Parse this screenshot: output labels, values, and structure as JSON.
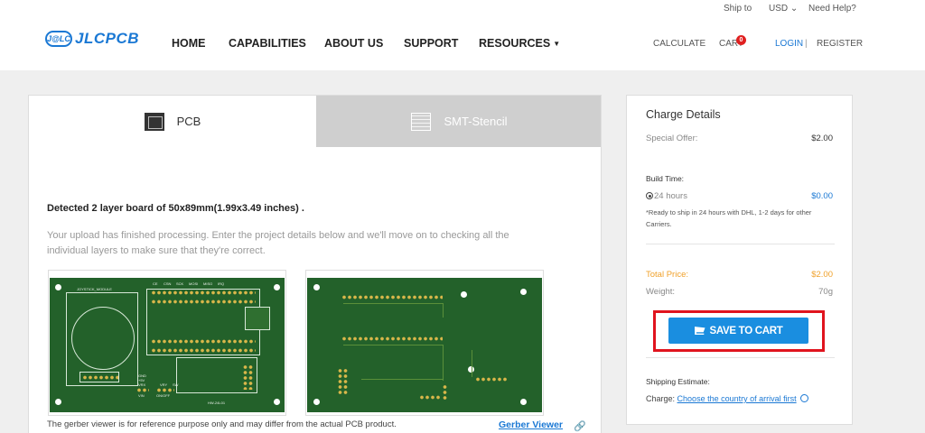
{
  "header": {
    "ship_to": "Ship to",
    "currency": "USD",
    "help": "Need Help?",
    "logo_badge": "J@LC",
    "logo_text": "JLCPCB",
    "nav": [
      "HOME",
      "CAPABILITIES",
      "ABOUT US",
      "SUPPORT",
      "RESOURCES"
    ],
    "calculate": "CALCULATE",
    "cart": "CART",
    "cart_count": "0",
    "login": "LOGIN",
    "separator": "|",
    "register": "REGISTER"
  },
  "tabs": {
    "pcb": "PCB",
    "smt": "SMT-Stencil"
  },
  "main": {
    "detected": "Detected 2 layer board of 50x89mm(1.99x3.49 inches) .",
    "description": "Your upload has finished processing. Enter the project details below and we'll move on to checking all the individual layers to make sure that they're correct.",
    "note": "The gerber viewer is for reference purpose only and may differ from the actual PCB product.",
    "gerber_viewer": "Gerber Viewer",
    "front_silk_title": "JOYSTICK_MODULE",
    "front_silk_id": "HW-24L01",
    "front_silk_labels": [
      "GND",
      "+5V",
      "VRX",
      "VRY",
      "SW"
    ],
    "front_silk_small": [
      "CE",
      "CSN",
      "SCK",
      "MOSI",
      "MISO",
      "IRQ",
      "VIN",
      "ON/OFF"
    ]
  },
  "charge": {
    "title": "Charge Details",
    "special_offer_label": "Special Offer:",
    "special_offer_value": "$2.00",
    "build_time_label": "Build Time:",
    "build_option": "24 hours",
    "build_price": "$0.00",
    "build_note": "*Ready to ship in 24 hours with DHL, 1-2 days for other Carriers.",
    "total_label": "Total Price:",
    "total_value": "$2.00",
    "weight_label": "Weight:",
    "weight_value": "70g",
    "save_to_cart": "SAVE TO CART",
    "shipping_label": "Shipping Estimate:",
    "charge_label": "Charge:",
    "country_link": "Choose the country of arrival first"
  },
  "colors": {
    "brand_blue": "#1a78d4",
    "button_blue": "#1a8ee0",
    "highlight_red": "#e0141e",
    "orange": "#f0a12a",
    "board_green": "#23612a"
  }
}
